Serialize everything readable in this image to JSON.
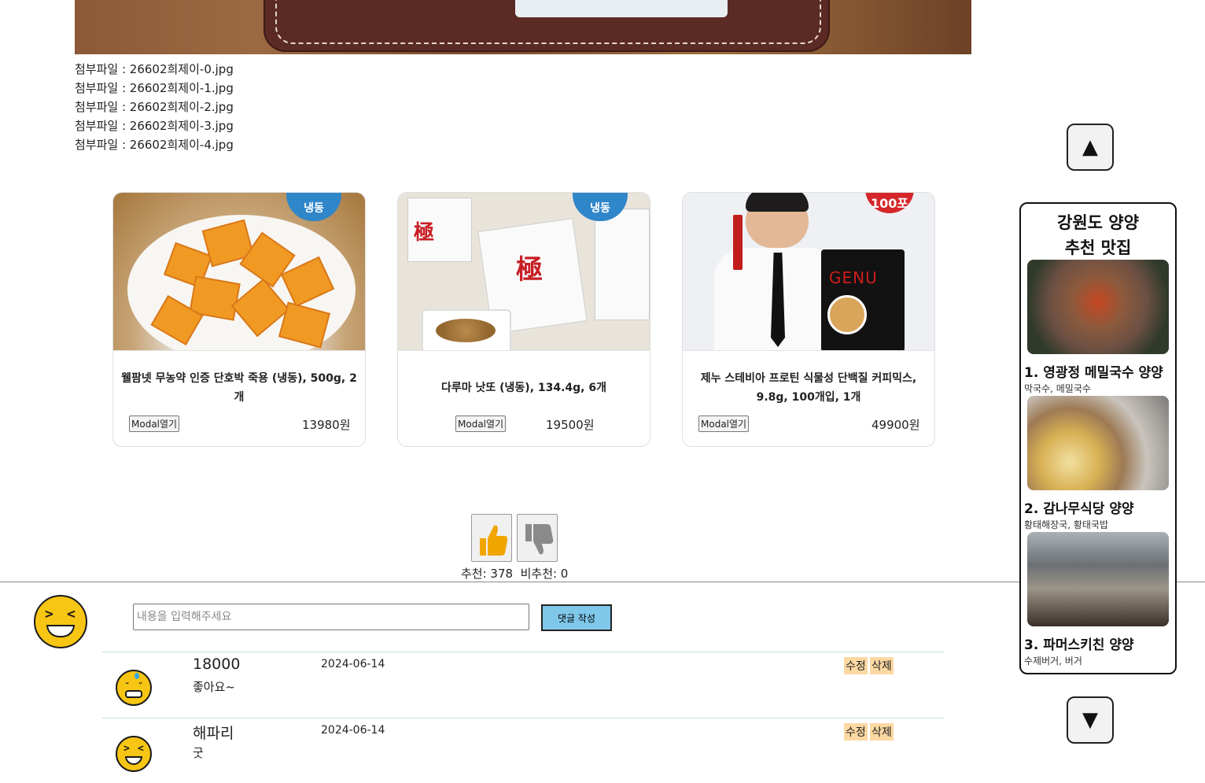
{
  "attachments": [
    "첨부파일 : 26602희제이-0.jpg",
    "첨부파일 : 26602희제이-1.jpg",
    "첨부파일 : 26602희제이-2.jpg",
    "첨부파일 : 26602희제이-3.jpg",
    "첨부파일 : 26602희제이-4.jpg"
  ],
  "products": [
    {
      "title_line1": "웰팜넷 무농약 인증 단호박 죽용 (냉동), 500g, 2",
      "title_line2": "개",
      "badge": "냉동",
      "modal_label": "Modal열기",
      "price": "13980원"
    },
    {
      "title_line1": "다루마 낫또 (냉동), 134.4g, 6개",
      "title_line2": "",
      "badge": "냉동",
      "modal_label": "Modal열기",
      "price": "19500원"
    },
    {
      "title_line1": "제누 스테비아 프로틴 식물성 단백질 커피믹스,",
      "title_line2": "9.8g, 100개입, 1개",
      "badge": "100포",
      "brand": "GENU",
      "modal_label": "Modal열기",
      "price": "49900원"
    }
  ],
  "votes": {
    "text": "추천: 378  비추천: 0",
    "up": 378,
    "down": 0
  },
  "composer": {
    "placeholder": "내용을 입력해주세요",
    "submit_label": "댓글 작성"
  },
  "comments": [
    {
      "author": "18000",
      "date": "2024-06-14",
      "text": "좋아요~",
      "edit_label": "수정",
      "delete_label": "삭제"
    },
    {
      "author": "해파리",
      "date": "2024-06-14",
      "text": "굿",
      "edit_label": "수정",
      "delete_label": "삭제"
    }
  ],
  "side": {
    "title_line1": "강원도 양양",
    "title_line2": "추천 맛집",
    "up_icon": "▲",
    "down_icon": "▼",
    "restaurants": [
      {
        "name": "1. 영광정 메밀국수 양양",
        "menu": "막국수, 메밀국수"
      },
      {
        "name": "2. 감나무식당 양양",
        "menu": "황태해장국, 황태국밥"
      },
      {
        "name": "3. 파머스키친 양양",
        "menu": "수제버거, 버거"
      }
    ]
  },
  "icons": {
    "thumbs_up": "thumbs-up-icon",
    "thumbs_down": "thumbs-down-icon"
  },
  "colors": {
    "accent_button": "#7fc8ea",
    "comment_action_bg": "#fcd8a2",
    "thumb_up": "#f0a500",
    "thumb_down": "#8a8a8a",
    "emoji_yellow": "#f7c513"
  }
}
